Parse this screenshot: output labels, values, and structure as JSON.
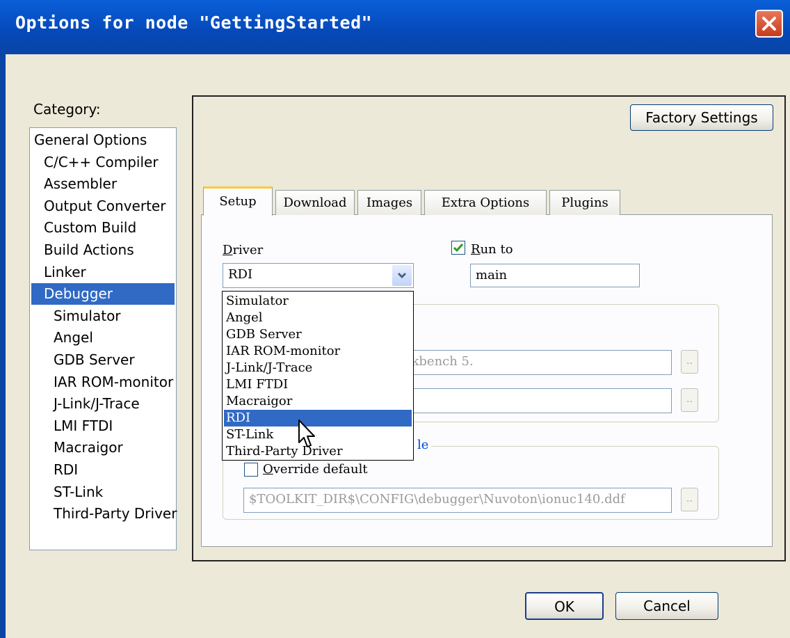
{
  "window": {
    "title": "Options for node \"GettingStarted\""
  },
  "category": {
    "label": "Category:",
    "items": [
      {
        "label": "General Options",
        "indent": 0
      },
      {
        "label": "C/C++ Compiler",
        "indent": 1
      },
      {
        "label": "Assembler",
        "indent": 1
      },
      {
        "label": "Output Converter",
        "indent": 1
      },
      {
        "label": "Custom Build",
        "indent": 1
      },
      {
        "label": "Build Actions",
        "indent": 1
      },
      {
        "label": "Linker",
        "indent": 1
      },
      {
        "label": "Debugger",
        "indent": 1,
        "selected": true
      },
      {
        "label": "Simulator",
        "indent": 2
      },
      {
        "label": "Angel",
        "indent": 2
      },
      {
        "label": "GDB Server",
        "indent": 2
      },
      {
        "label": "IAR ROM-monitor",
        "indent": 2
      },
      {
        "label": "J-Link/J-Trace",
        "indent": 2
      },
      {
        "label": "LMI FTDI",
        "indent": 2
      },
      {
        "label": "Macraigor",
        "indent": 2
      },
      {
        "label": "RDI",
        "indent": 2
      },
      {
        "label": "ST-Link",
        "indent": 2
      },
      {
        "label": "Third-Party Driver",
        "indent": 2
      }
    ]
  },
  "factory_settings": "Factory Settings",
  "tabs": [
    "Setup",
    "Download",
    "Images",
    "Extra Options",
    "Plugins"
  ],
  "setup": {
    "driver_label_prefix": "D",
    "driver_label_rest": "river",
    "driver_value": "RDI",
    "run_to_label_prefix": "R",
    "run_to_label_rest": "un to",
    "run_to_checked": true,
    "run_to_value": "main",
    "setup_macros_path": ". Systems\\Embedded Workbench 5.",
    "setup_macros_path2": "",
    "device_desc_legend_tail": "le",
    "override_label_prefix": "O",
    "override_label_rest": "verride default",
    "override_checked": false,
    "ddf_path": "$TOOLKIT_DIR$\\CONFIG\\debugger\\Nuvoton\\ionuc140.ddf",
    "browse": ".."
  },
  "driver_options": [
    "Simulator",
    "Angel",
    "GDB Server",
    "IAR ROM-monitor",
    "J-Link/J-Trace",
    "LMI FTDI",
    "Macraigor",
    "RDI",
    "ST-Link",
    "Third-Party Driver"
  ],
  "driver_selected_index": 7,
  "buttons": {
    "ok": "OK",
    "cancel": "Cancel"
  }
}
